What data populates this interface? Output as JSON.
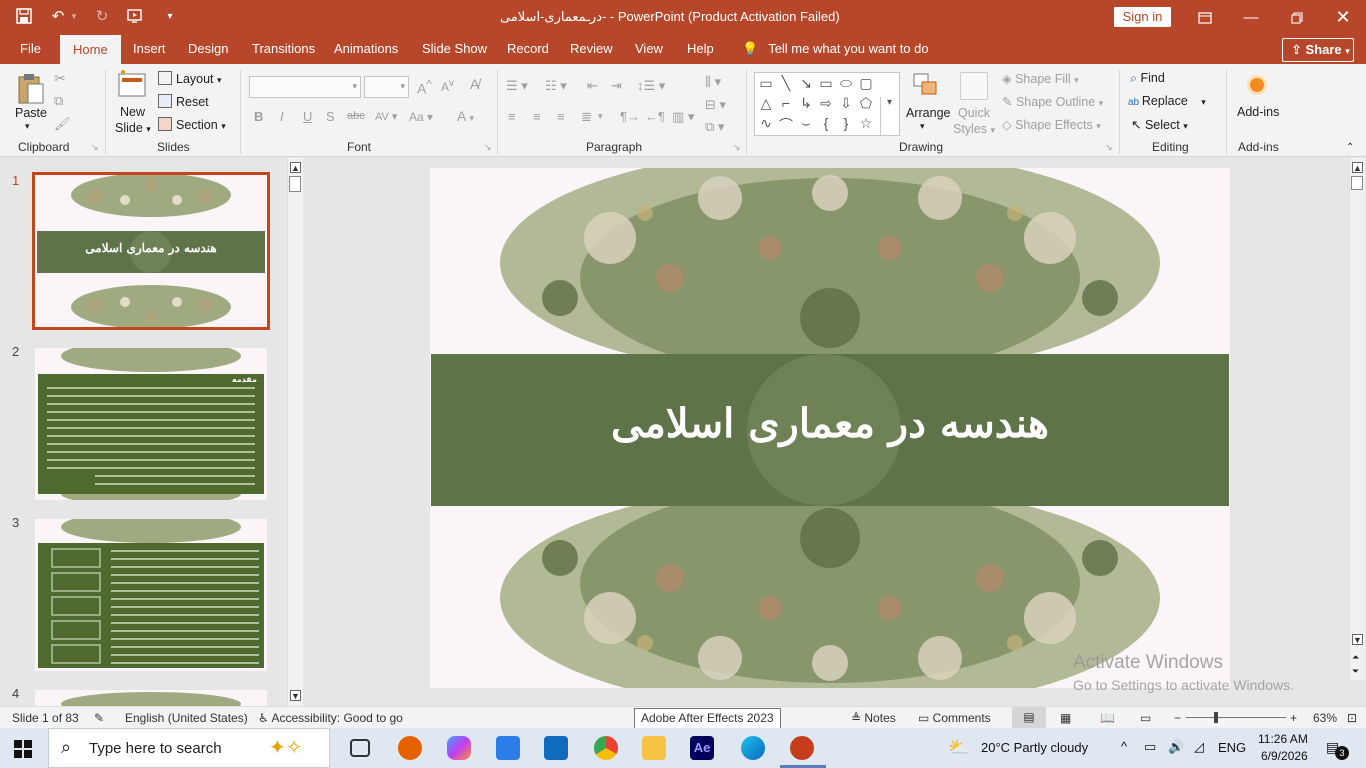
{
  "titlebar": {
    "title": "درـمعماری-اسلامی- - PowerPoint (Product Activation Failed)",
    "signin": "Sign in",
    "accent": "#b7472a"
  },
  "tabs": [
    "File",
    "Home",
    "Insert",
    "Design",
    "Transitions",
    "Animations",
    "Slide Show",
    "Record",
    "Review",
    "View",
    "Help"
  ],
  "active_tab": "Home",
  "tell_me": "Tell me what you want to do",
  "share": "Share",
  "ribbon": {
    "clipboard": {
      "paste": "Paste",
      "label": "Clipboard"
    },
    "slides": {
      "new_slide_1": "New",
      "new_slide_2": "Slide",
      "layout": "Layout",
      "reset": "Reset",
      "section": "Section",
      "label": "Slides"
    },
    "font": {
      "label": "Font"
    },
    "paragraph": {
      "label": "Paragraph"
    },
    "drawing": {
      "arrange": "Arrange",
      "quick_styles_1": "Quick",
      "quick_styles_2": "Styles",
      "shape_fill": "Shape Fill",
      "shape_outline": "Shape Outline",
      "shape_effects": "Shape Effects",
      "label": "Drawing"
    },
    "editing": {
      "find": "Find",
      "replace": "Replace",
      "select": "Select",
      "label": "Editing"
    },
    "addins": {
      "button": "Add-ins",
      "label": "Add-ins"
    }
  },
  "slides_pane": {
    "numbers": [
      "1",
      "2",
      "3",
      "4"
    ],
    "thumb1_title": "هندسه در معماری اسلامی",
    "thumb2_heading": "مقدمه"
  },
  "slide": {
    "title": "هندسه در معماری اسلامی",
    "band_color": "#5e7448"
  },
  "watermark": {
    "line1": "Activate Windows",
    "line2": "Go to Settings to activate Windows."
  },
  "statusbar": {
    "slide_of": "Slide 1 of 83",
    "language": "English (United States)",
    "accessibility": "Accessibility: Good to go",
    "notes": "Notes",
    "comments": "Comments",
    "zoom": "63%"
  },
  "tooltip": "Adobe After Effects 2023",
  "taskbar": {
    "search_placeholder": "Type here to search",
    "weather": "20°C  Partly cloudy",
    "lang": "ENG",
    "time": "11:26 AM",
    "date": "6/9/2026",
    "notif": "3"
  }
}
